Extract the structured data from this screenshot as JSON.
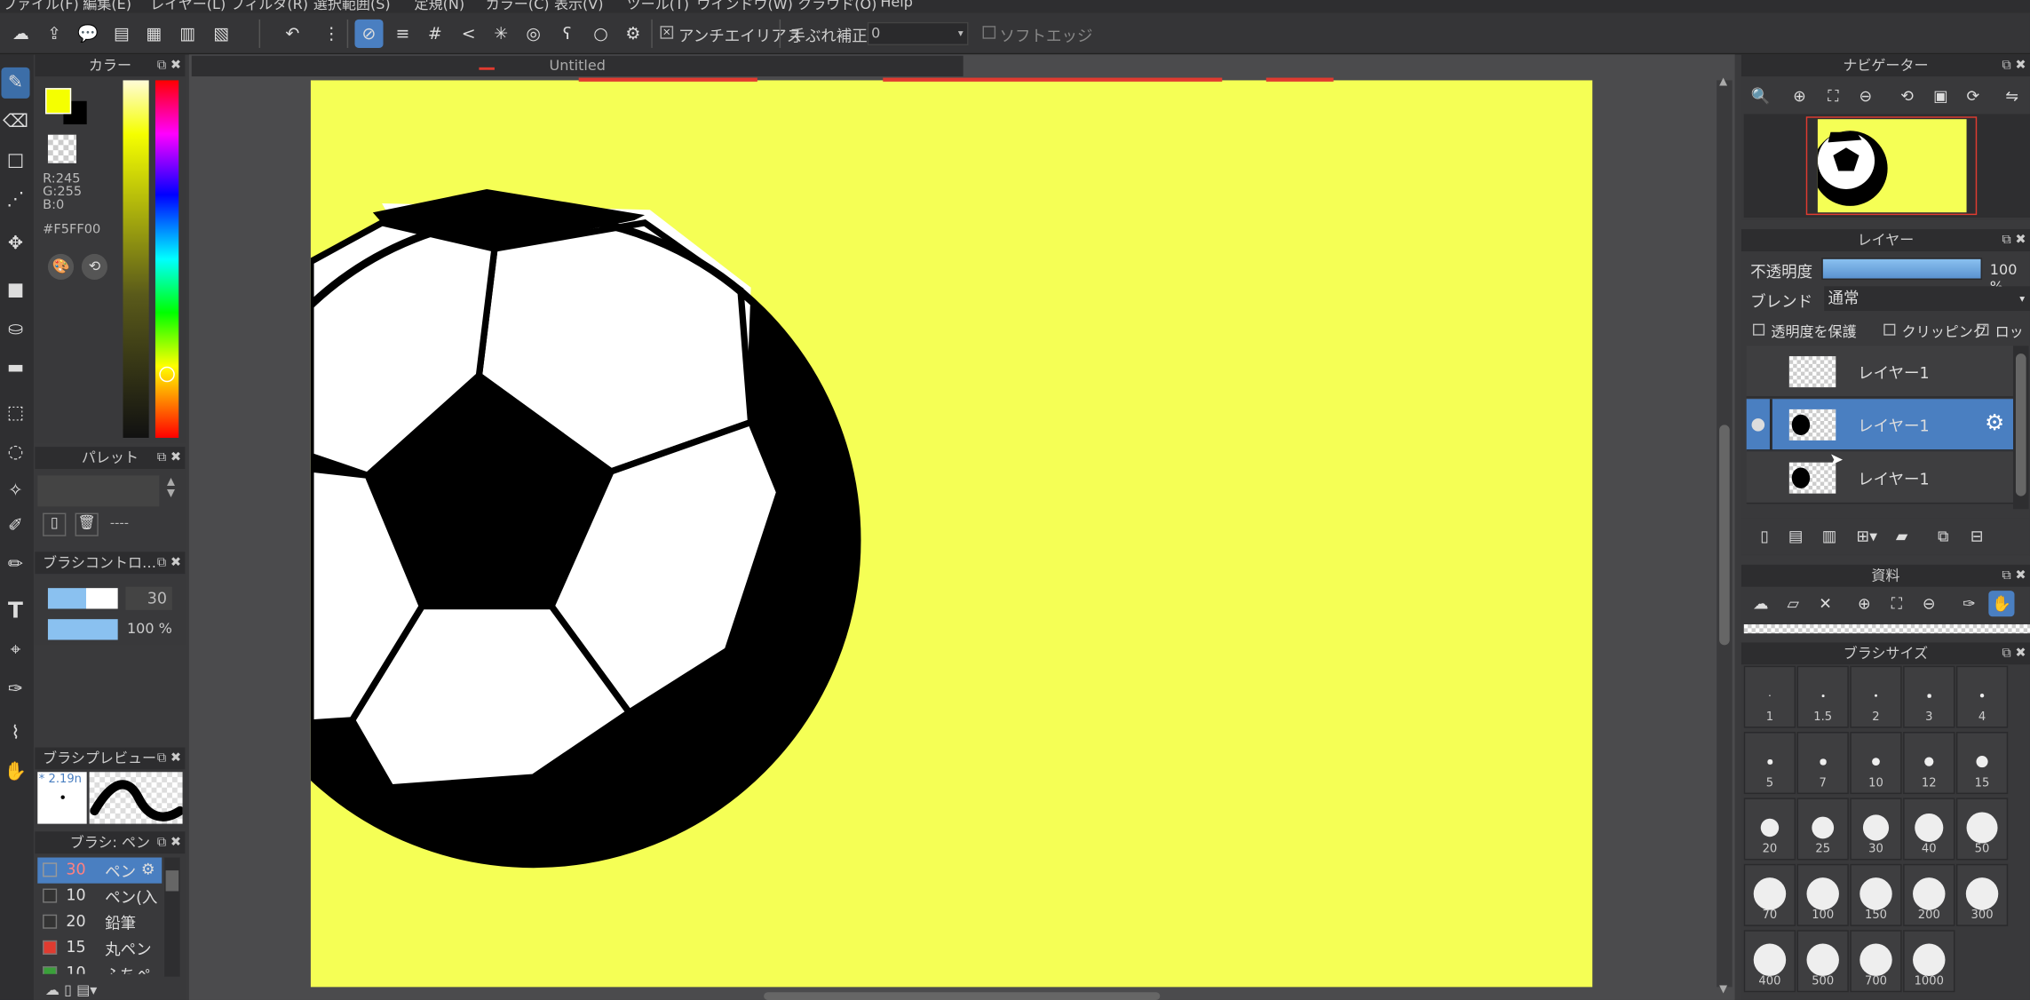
{
  "menu": [
    "ファイル(F)",
    "編集(E)",
    "レイヤー(L)",
    "フィルタ(R)",
    "選択範囲(S)",
    "定規(N)",
    "カラー(C)",
    "表示(V)",
    "ツール(T)",
    "ウインドウ(W)",
    "クラウド(O)",
    "Help"
  ],
  "toolbar": {
    "antialias": "アンチエイリアス",
    "stabilizer_label": "手ぶれ補正",
    "stabilizer_value": "0",
    "soft_edge": "ソフトエッジ"
  },
  "document": {
    "title": "Untitled",
    "background": "#f5ff55"
  },
  "color_panel": {
    "title": "カラー",
    "r": "R:245",
    "g": "G:255",
    "b": "B:0",
    "hex": "#F5FF00",
    "fg": "#f5ff00"
  },
  "palette_panel": {
    "title": "パレット",
    "value": "----"
  },
  "brush_control": {
    "title": "ブラシコントロ…",
    "size": "30",
    "opacity": "100 %"
  },
  "brush_preview": {
    "title": "ブラシプレビュー",
    "size": "* 2.19n"
  },
  "brush_list": {
    "title": "ブラシ: ペン",
    "items": [
      {
        "size": "30",
        "name": "ペン",
        "color": "#333"
      },
      {
        "size": "10",
        "name": "ペン(入",
        "color": "#333"
      },
      {
        "size": "20",
        "name": "鉛筆",
        "color": "#333"
      },
      {
        "size": "15",
        "name": "丸ペン",
        "color": "#e03b30"
      },
      {
        "size": "10",
        "name": "ふちペ",
        "color": "#3aa03a"
      }
    ]
  },
  "navigator": {
    "title": "ナビゲーター"
  },
  "layers": {
    "title": "レイヤー",
    "opacity_label": "不透明度",
    "opacity_value": "100 %",
    "blend_label": "ブレンド",
    "blend_value": "通常",
    "protect": "透明度を保護",
    "clipping": "クリッピング",
    "lock": "ロック",
    "items": [
      {
        "name": "レイヤー1"
      },
      {
        "name": "レイヤー1"
      },
      {
        "name": "レイヤー1"
      }
    ]
  },
  "materials": {
    "title": "資料"
  },
  "brush_size": {
    "title": "ブラシサイズ",
    "sizes": [
      "1",
      "1.5",
      "2",
      "3",
      "4",
      "5",
      "7",
      "10",
      "12",
      "15",
      "20",
      "25",
      "30",
      "40",
      "50",
      "70",
      "100",
      "150",
      "200",
      "300",
      "400",
      "500",
      "700",
      "1000"
    ]
  }
}
